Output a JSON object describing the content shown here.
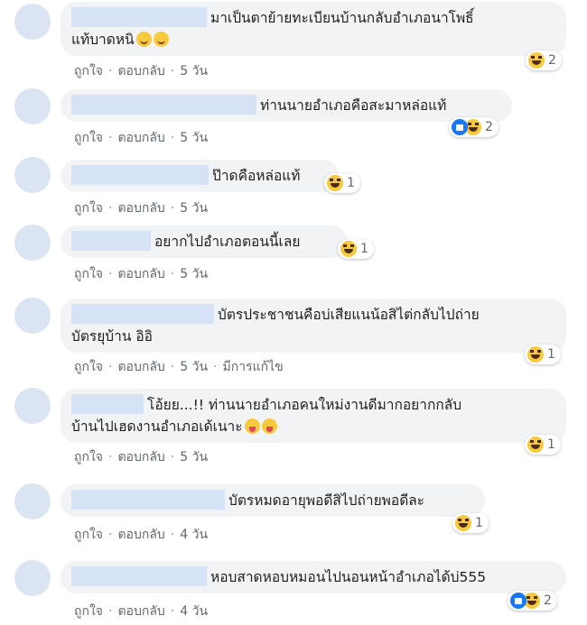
{
  "actions": {
    "like": "ถูกใจ",
    "reply": "ตอบกลับ",
    "edited": "มีการแก้ไข"
  },
  "comments": [
    {
      "text_line1": "มาเป็นตาย้ายทะเบียนบ้านกลับอำเภอนาโพธิ์",
      "text_line2": "แท้บาดหนิ",
      "time": "5 วัน",
      "reactions": [
        "haha"
      ],
      "reaction_count": "2"
    },
    {
      "text": "ท่านนายอำเภอคือสะมาหล่อแท้",
      "time": "5 วัน",
      "reactions": [
        "like",
        "haha"
      ],
      "reaction_count": "2"
    },
    {
      "text": "ป๊าดคือหล่อแท้",
      "time": "5 วัน",
      "reactions": [
        "haha"
      ],
      "reaction_count": "1"
    },
    {
      "text": "อยากไปอำเภอตอนนี้เลย",
      "time": "5 วัน",
      "reactions": [
        "haha"
      ],
      "reaction_count": "1"
    },
    {
      "text_line1": "บัตรประชาชนคือบ่เสียแนน้อสิไต่กลับไปถ่าย",
      "text_line2": "บัตรยุบ้าน อิอิ",
      "time": "5 วัน",
      "edited": true,
      "reactions": [
        "haha"
      ],
      "reaction_count": "1"
    },
    {
      "text_line1": "โอ้ยย...!! ท่านนายอำเภอคนใหม่งานดีมากอยากกลับ",
      "text_line2": "บ้านไปเฮดงานอำเภอเด้เนาะ",
      "time": "5 วัน",
      "reactions": [
        "haha"
      ],
      "reaction_count": "1"
    },
    {
      "text": "บัตรหมดอายุพอดีสิไปถ่ายพอดีละ",
      "time": "4 วัน",
      "reactions": [
        "haha"
      ],
      "reaction_count": "1"
    },
    {
      "text": "หอบสาดหอบหมอนไปนอนหน้าอำเภอได้บ่555",
      "time": "4 วัน",
      "reactions": [
        "like",
        "haha"
      ],
      "reaction_count": "2"
    }
  ]
}
